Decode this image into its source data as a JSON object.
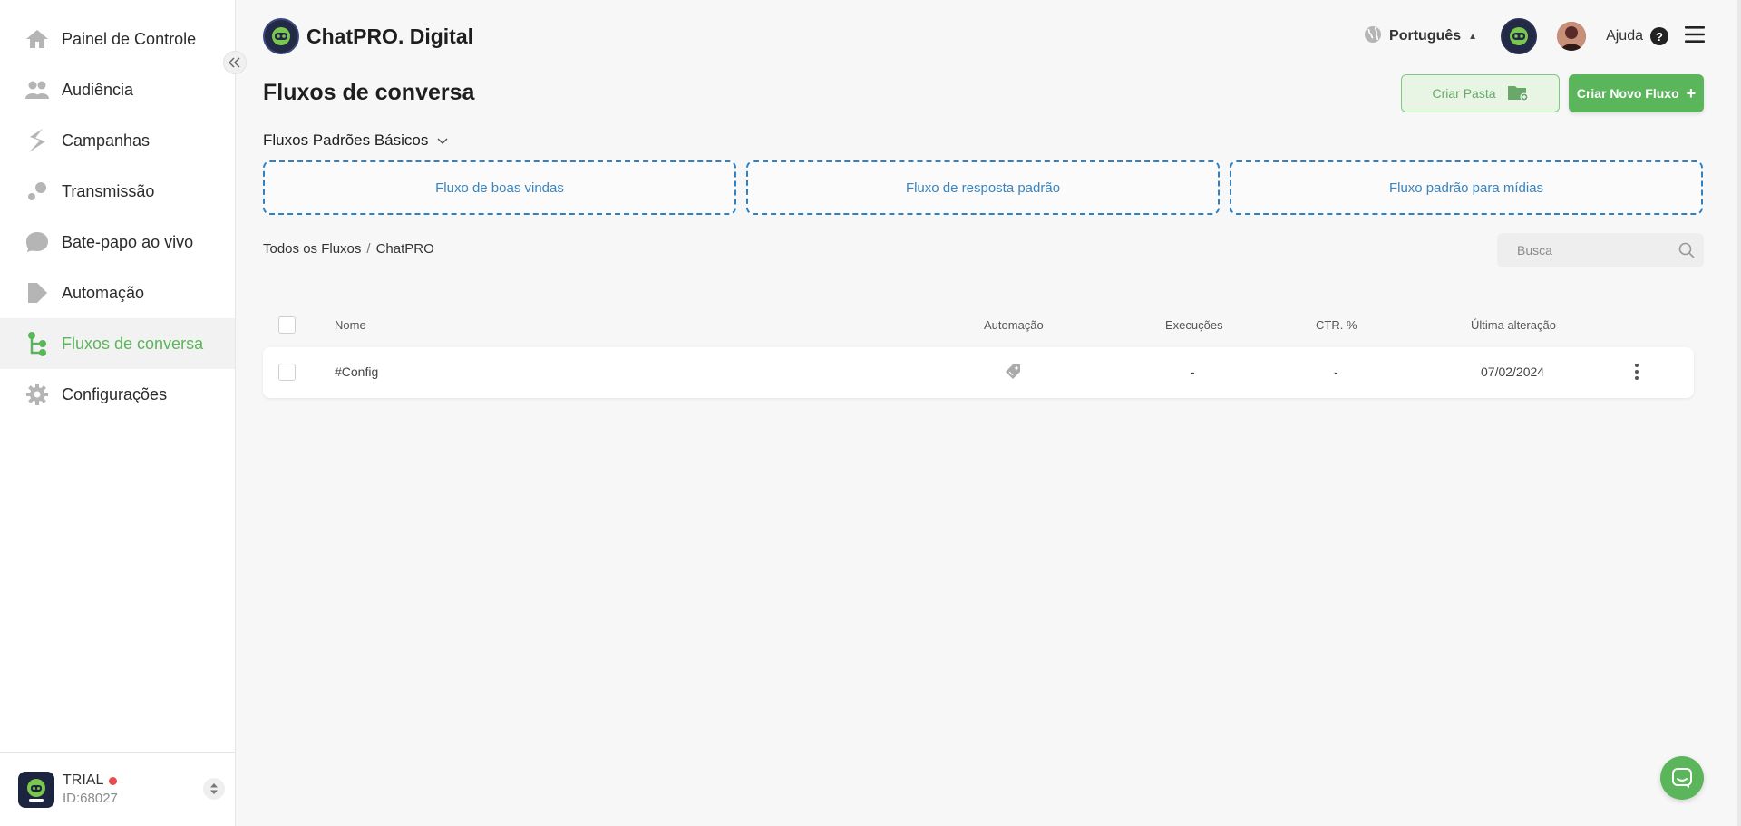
{
  "sidebar": {
    "items": [
      {
        "label": "Painel de Controle",
        "icon": "home-icon"
      },
      {
        "label": "Audiência",
        "icon": "people-icon"
      },
      {
        "label": "Campanhas",
        "icon": "campaign-icon"
      },
      {
        "label": "Transmissão",
        "icon": "broadcast-icon"
      },
      {
        "label": "Bate-papo ao vivo",
        "icon": "chat-bubble-icon"
      },
      {
        "label": "Automação",
        "icon": "automation-icon"
      },
      {
        "label": "Fluxos de conversa",
        "icon": "flow-icon"
      },
      {
        "label": "Configurações",
        "icon": "gear-icon"
      }
    ],
    "active_index": 6,
    "account": {
      "plan": "TRIAL",
      "id": "ID:68027"
    }
  },
  "header": {
    "brand": "ChatPRO. Digital",
    "language": "Português",
    "help": "Ajuda"
  },
  "main": {
    "title": "Fluxos de conversa",
    "create_folder": "Criar Pasta",
    "create_flow": "Criar Novo Fluxo",
    "defaults_title": "Fluxos Padrões Básicos",
    "default_flows": [
      "Fluxo de boas vindas",
      "Fluxo de resposta padrão",
      "Fluxo padrão para mídias"
    ],
    "breadcrumb": {
      "root": "Todos os Fluxos",
      "separator": "/",
      "current": "ChatPRO"
    },
    "search_placeholder": "Busca",
    "table": {
      "headers": {
        "name": "Nome",
        "automation": "Automação",
        "executions": "Execuções",
        "ctr": "CTR. %",
        "last_modified": "Última alteração"
      },
      "rows": [
        {
          "name": "#Config",
          "automation_icon": "tag-icon",
          "executions": "-",
          "ctr": "-",
          "last_modified": "07/02/2024"
        }
      ]
    }
  },
  "colors": {
    "accent": "#5bb55b",
    "link": "#3a84c0",
    "dashed_border": "#2e82c4",
    "trial_dot": "#e84c4c"
  }
}
